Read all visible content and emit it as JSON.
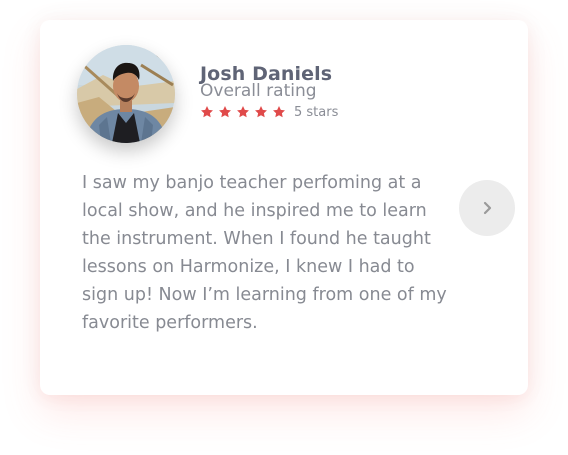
{
  "review": {
    "name": "Josh Daniels",
    "subtitle": "Overall rating",
    "rating": 5,
    "rating_max": 5,
    "stars_label": "5 stars",
    "quote": "I saw my banjo teacher perfoming at a local show, and he inspired me to learn the instrument. When I found he taught lessons on Harmonize, I knew I had to sign up! Now I’m learning from one of my favorite performers."
  },
  "icons": {
    "star": "star-icon",
    "next": "chevron-right-icon"
  },
  "colors": {
    "star": "#e04a4a",
    "name": "#5f6476",
    "text": "#878a92",
    "button_bg": "#ececec",
    "button_icon": "#9a9a9a"
  }
}
